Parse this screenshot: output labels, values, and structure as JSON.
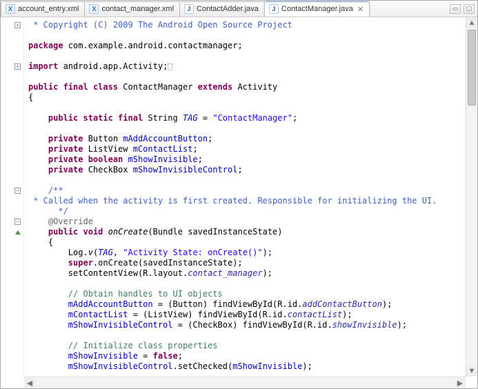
{
  "tabs": [
    {
      "label": "account_entry.xml",
      "icon": "X"
    },
    {
      "label": "contact_manager.xml",
      "icon": "X"
    },
    {
      "label": "ContactAdder.java",
      "icon": "J"
    },
    {
      "label": "ContactManager.java",
      "icon": "J",
      "active": true
    }
  ],
  "gutter": {
    "plus": "+",
    "minus": "−"
  },
  "code": {
    "l1a": " * Copyright (C) 2009 The Android Open Source Project",
    "l3_kw": "package",
    "l3_b": " com.example.android.contactmanager;",
    "l5_kw": "import",
    "l5_b": " android.app.Activity;",
    "l7_a": "public final class",
    "l7_b": " ContactManager ",
    "l7_c": "extends",
    "l7_d": " Activity",
    "l8": "{",
    "l10_a": "public static final",
    "l10_b": " String ",
    "l10_c": "TAG",
    "l10_d": " = ",
    "l10_e": "\"ContactManager\"",
    "l10_f": ";",
    "l12_a": "private",
    "l12_b": " Button ",
    "l12_c": "mAddAccountButton",
    "l12_d": ";",
    "l13_a": "private",
    "l13_b": " ListView ",
    "l13_c": "mContactList",
    "l13_d": ";",
    "l14_a": "private boolean",
    "l14_b": " ",
    "l14_c": "mShowInvisible",
    "l14_d": ";",
    "l15_a": "private",
    "l15_b": " CheckBox ",
    "l15_c": "mShowInvisibleControl",
    "l15_d": ";",
    "l17": "/**",
    "l18": " * Called when the activity is first created. Responsible for initializing the UI.",
    "l19": " */",
    "l20": "@Override",
    "l21_a": "public void",
    "l21_b": " onCreate",
    "l21_c": "(Bundle savedInstanceState)",
    "l22": "{",
    "l23_a": "Log.",
    "l23_b": "v",
    "l23_c": "(",
    "l23_d": "TAG",
    "l23_e": ", ",
    "l23_f": "\"Activity State: onCreate()\"",
    "l23_g": ");",
    "l24_a": "super",
    "l24_b": ".onCreate(savedInstanceState);",
    "l25_a": "setContentView(R.layout.",
    "l25_b": "contact_manager",
    "l25_c": ");",
    "l27": "// Obtain handles to UI objects",
    "l28_a": "mAddAccountButton",
    "l28_b": " = (Button) findViewById(R.id.",
    "l28_c": "addContactButton",
    "l28_d": ");",
    "l29_a": "mContactList",
    "l29_b": " = (ListView) findViewById(R.id.",
    "l29_c": "contactList",
    "l29_d": ");",
    "l30_a": "mShowInvisibleControl",
    "l30_b": " = (CheckBox) findViewById(R.id.",
    "l30_c": "showInvisible",
    "l30_d": ");",
    "l32": "// Initialize class properties",
    "l33_a": "mShowInvisible",
    "l33_b": " = ",
    "l33_c": "false",
    "l33_d": ";",
    "l34_a": "mShowInvisibleControl",
    "l34_b": ".setChecked(",
    "l34_c": "mShowInvisible",
    "l34_d": ");"
  }
}
